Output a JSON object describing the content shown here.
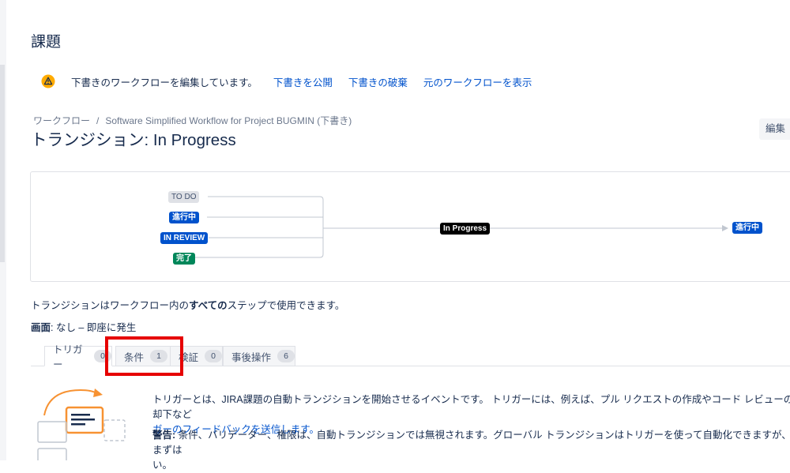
{
  "page_heading": "課題",
  "draft_bar": {
    "message": "下書きのワークフローを編集しています。",
    "publish_link": "下書きを公開",
    "discard_link": "下書きの破棄",
    "view_original_link": "元のワークフローを表示"
  },
  "breadcrumb": {
    "root": "ワークフロー",
    "separator": "/",
    "workflow_name": "Software Simplified Workflow for Project BUGMIN (下書き)"
  },
  "transition_title": "トランジション: In Progress",
  "edit_button": "編集",
  "diagram": {
    "source_statuses": [
      {
        "label": "TO DO",
        "style": "todo"
      },
      {
        "label": "進行中",
        "style": "blue"
      },
      {
        "label": "IN REVIEW",
        "style": "blue"
      },
      {
        "label": "完了",
        "style": "green"
      }
    ],
    "transition_label": "In Progress",
    "target_status": "進行中"
  },
  "steps_note": {
    "prefix": "トランジションはワークフロー内の",
    "emphasis": "すべての",
    "suffix": "ステップで使用できます。"
  },
  "screen_line": {
    "label": "画面",
    "value": ": なし – 即座に発生"
  },
  "tabs": [
    {
      "label": "トリガー",
      "count": "0",
      "active": true
    },
    {
      "label": "条件",
      "count": "1",
      "active": false
    },
    {
      "label": "検証",
      "count": "0",
      "active": false
    },
    {
      "label": "事後操作",
      "count": "6",
      "active": false
    }
  ],
  "trigger_panel": {
    "description": "トリガーとは、JIRA課題の自動トランジションを開始させるイベントです。 トリガーには、例えば、プル リクエストの作成やコード レビューの却下など",
    "description_link": "ガーのフィードバックを送信します。",
    "warning_label": "警告:",
    "warning_text": " 条件、バリデーター、権限は、自動トランジションでは無視されます。グローバル トランジションはトリガーを使って自動化できますが、まずは",
    "warning_tail": "い。"
  },
  "colors": {
    "link": "#0052cc",
    "status_blue": "#0052cc",
    "status_green": "#00875a",
    "highlight": "#e60000",
    "warning_icon": "#ffab00"
  },
  "icons": [
    "warning-icon",
    "trigger-illustration"
  ]
}
